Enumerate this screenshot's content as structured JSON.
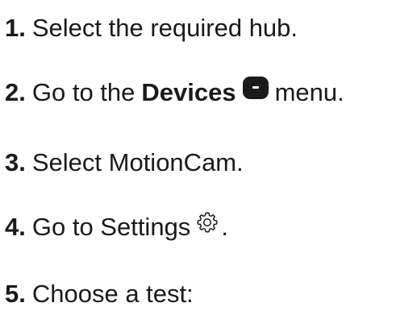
{
  "steps": [
    {
      "num": "1.",
      "text": "Select the required hub."
    },
    {
      "num": "2.",
      "text_before": "Go to the",
      "bold": "Devices",
      "icon": "devices-menu-icon",
      "text_after": "menu."
    },
    {
      "num": "3.",
      "text": "Select MotionCam."
    },
    {
      "num": "4.",
      "text_before": "Go to Settings",
      "icon": "gear-icon",
      "text_after": "."
    },
    {
      "num": "5.",
      "text": "Choose a test:"
    }
  ],
  "colors": {
    "text": "#1a1a1a",
    "background": "#ffffff"
  }
}
